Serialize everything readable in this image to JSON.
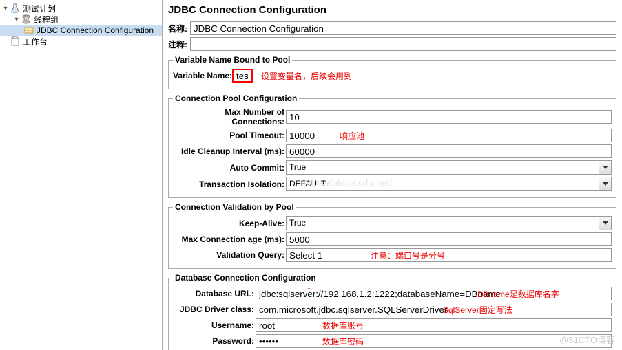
{
  "tree": {
    "plan": "测试计划",
    "thread_group": "线程组",
    "jdbc_config": "JDBC Connection Configuration",
    "workbench": "工作台"
  },
  "page_title": "JDBC Connection Configuration",
  "name_row": {
    "label": "名称:",
    "value": "JDBC Connection Configuration"
  },
  "comment_row": {
    "label": "注释:"
  },
  "varpool": {
    "legend": "Variable Name Bound to Pool",
    "label": "Variable Name:",
    "value": "test",
    "annotation": "设置变量名，后续会用到"
  },
  "connpool": {
    "legend": "Connection Pool Configuration",
    "max_connections": {
      "label": "Max Number of Connections:",
      "value": "10"
    },
    "pool_timeout": {
      "label": "Pool Timeout:",
      "value": "10000",
      "annotation": "响应池"
    },
    "idle_cleanup": {
      "label": "Idle Cleanup Interval (ms):",
      "value": "60000"
    },
    "auto_commit": {
      "label": "Auto Commit:",
      "value": "True"
    },
    "txn_isolation": {
      "label": "Transaction Isolation:",
      "value": "DEFAULT"
    }
  },
  "validation": {
    "legend": "Connection Validation by Pool",
    "keep_alive": {
      "label": "Keep-Alive:",
      "value": "True"
    },
    "max_conn_age": {
      "label": "Max Connection age (ms):",
      "value": "5000"
    },
    "validation_query": {
      "label": "Validation Query:",
      "value": "Select 1",
      "annotation": "注意：端口号是分号"
    }
  },
  "dbconn": {
    "legend": "Database Connection Configuration",
    "db_url": {
      "label": "Database URL:",
      "value": "jdbc:sqlserver://192.168.1.2:1222;databaseName=DBname",
      "annotation": "DBname是数据库名字"
    },
    "driver": {
      "label": "JDBC Driver class:",
      "value": "com.microsoft.jdbc.sqlserver.SQLServerDriver",
      "annotation": "SqlServer固定写法"
    },
    "username": {
      "label": "Username:",
      "value": "root",
      "annotation": "数据库账号"
    },
    "password": {
      "label": "Password:",
      "value": "••••••",
      "annotation": "数据库密码"
    }
  },
  "watermark": "@51CTO博客",
  "wm_center": "https://blog.csdn.net/"
}
